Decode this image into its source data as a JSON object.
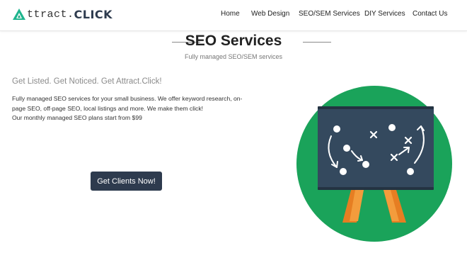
{
  "brand": {
    "name_part1": "ttract.",
    "name_part2": "CLICK",
    "colors": {
      "primary": "#2e3b4e",
      "accent_green": "#1aa35a",
      "logo_teal": "#1fb58e"
    }
  },
  "nav": {
    "items": [
      {
        "label": "Home"
      },
      {
        "label": "Web Design"
      },
      {
        "label": "SEO/SEM Services"
      },
      {
        "label": "DIY Services"
      },
      {
        "label": "Contact Us"
      }
    ]
  },
  "section": {
    "title": "SEO Services",
    "subtitle": "Fully managed SEO/SEM services"
  },
  "content": {
    "tagline": "Get Listed. Get Noticed. Get Attract.Click!",
    "description_line1": "Fully managed SEO services for your small business. We offer keyword research, on-page SEO, off-page SEO, local listings and more. We make them click!",
    "description_line2": "Our monthly managed SEO plans start from $99"
  },
  "cta": {
    "label": "Get Clients Now!"
  },
  "illustration": {
    "icon": "strategy-board-icon",
    "circle_color": "#1aa35a",
    "board_color": "#34495e",
    "stand_color": "#e67e22"
  }
}
